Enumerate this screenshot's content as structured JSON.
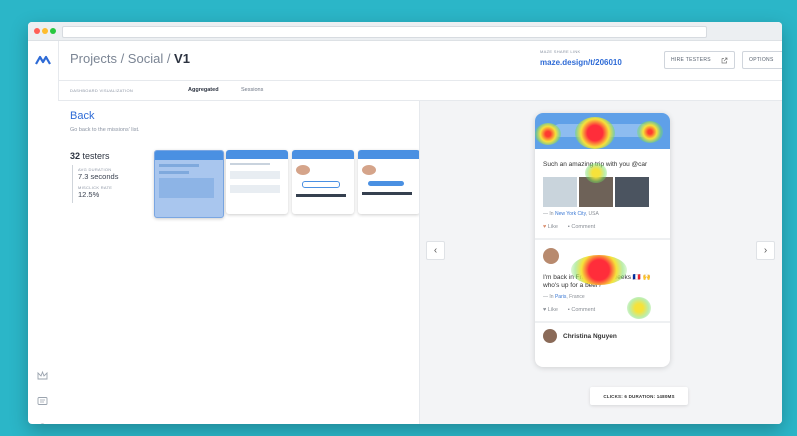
{
  "breadcrumb": {
    "path": "Projects / Social / ",
    "current": "V1"
  },
  "share": {
    "label": "MAZE SHARE LINK",
    "value": "maze.design/t/206010"
  },
  "toolbar": {
    "hire": "HIRE TESTERS",
    "options": "OPTIONS"
  },
  "tabs": [
    {
      "label": "DASHBOARD VISUALIZATION"
    },
    {
      "label": "Aggregated"
    },
    {
      "label": "Sessions"
    }
  ],
  "back": {
    "title": "Back",
    "subtitle": "Go back to the missions' list."
  },
  "summary": {
    "testers_count": "32",
    "testers_label": "testers",
    "avg_label": "AVG DURATION",
    "avg_value": "7.3 seconds",
    "misclick_label": "MISCLICK RATE",
    "misclick_value": "12.5%"
  },
  "phone": {
    "post1_text": "Such an amazing trip with you @car",
    "post1_loc_prefix": "— In ",
    "post1_loc": "New York City",
    "post1_loc_suffix": ", USA",
    "like": "Like",
    "comment": "Comment",
    "post2_text": "I'm back in France for 2 weeks 🇫🇷 🙌 who's up for a beer?",
    "post2_loc_prefix": "— In ",
    "post2_loc": "Paris",
    "post2_loc_suffix": ", France",
    "post3_name": "Christina Nguyen"
  },
  "footer": {
    "clicks": "CLICKS: 6   DURATION: 1480MS"
  },
  "colors": {
    "accent": "#2e6bd6",
    "background": "#2bb6c8",
    "phone_header": "#5fa0e8"
  }
}
